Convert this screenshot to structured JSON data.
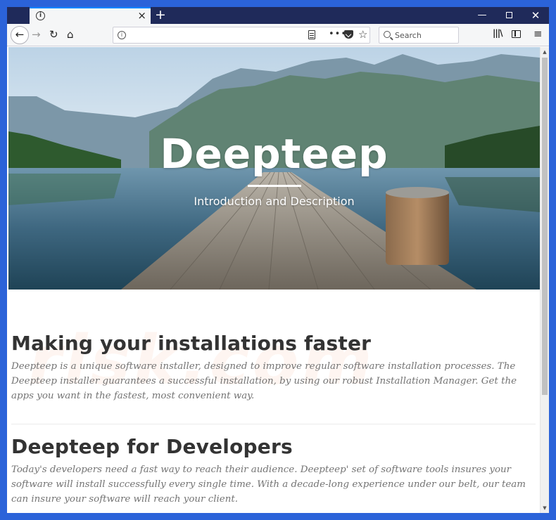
{
  "browser": {
    "tab": {
      "favicon": "i",
      "close": "×"
    },
    "new_tab": "+",
    "window_controls": {
      "minimize": "—",
      "close": "✕"
    },
    "nav": {
      "back": "←",
      "forward": "→",
      "reload": "↻",
      "home": "⌂"
    },
    "urlbar": {
      "info": "i",
      "dots": "•••",
      "star": "☆"
    },
    "search": {
      "placeholder": "Search"
    },
    "library": "|||\\",
    "menu": "≡"
  },
  "hero": {
    "title": "Deepteep",
    "subtitle": "Introduction and Description"
  },
  "watermark": "risk.com",
  "sections": [
    {
      "heading": "Making your installations faster",
      "body": "Deepteep is a unique software installer, designed to improve regular software installation processes. The Deepteep installer guarantees a successful installation, by using our robust Installation Manager. Get the apps you want in the fastest, most convenient way."
    },
    {
      "heading": "Deepteep for Developers",
      "body": "Today's developers need a fast way to reach their audience. Deepteep' set of software tools insures your software will install successfully every single time. With a decade-long experience under our belt, our team can insure your software will reach your client."
    }
  ],
  "colors": {
    "tabstrip": "#1f2a5a",
    "accent": "#0a84ff",
    "frame": "#2b63d9",
    "heading": "#333333",
    "body_text": "#747474"
  }
}
